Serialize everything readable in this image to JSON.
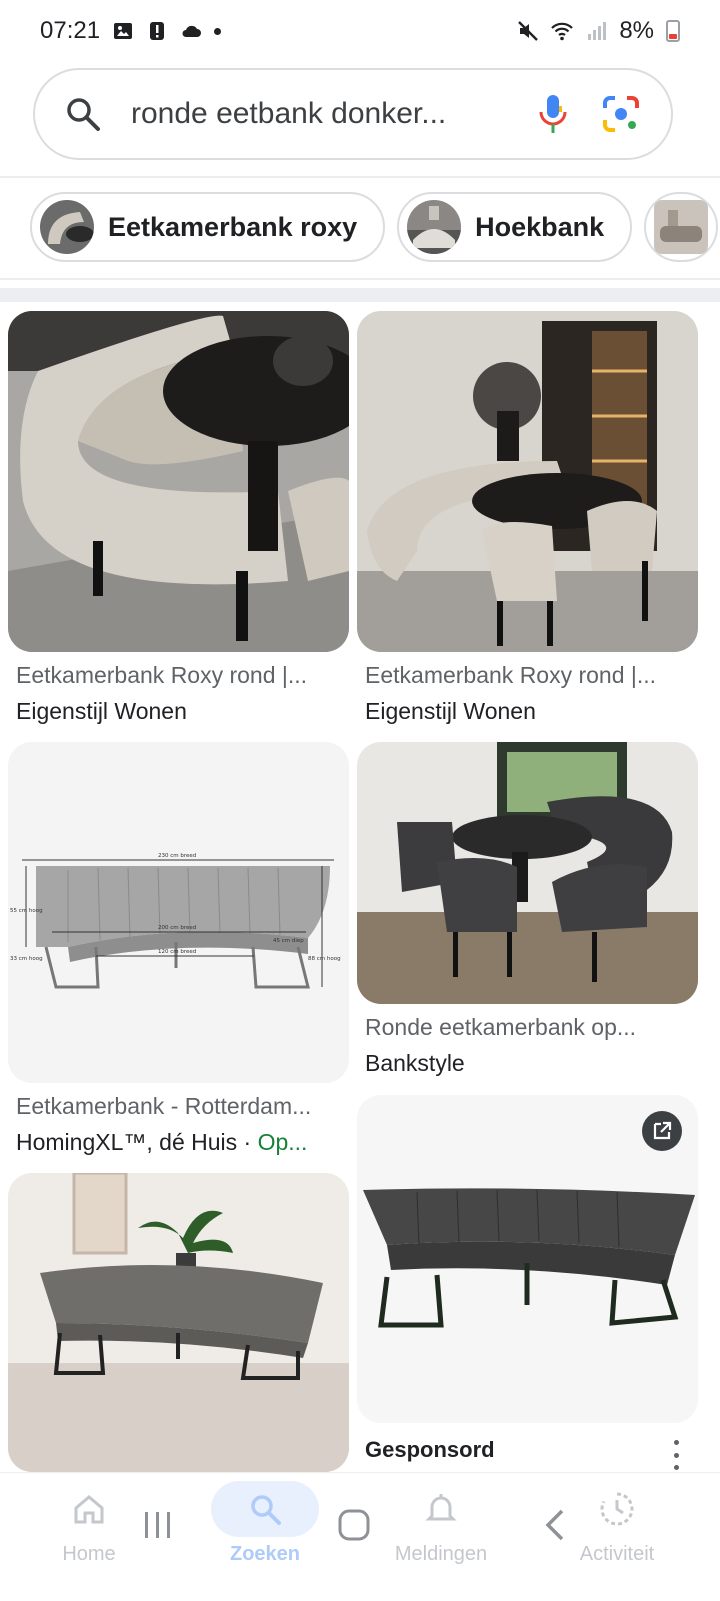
{
  "status_bar": {
    "time": "07:21",
    "battery": "8%",
    "icons": [
      "image-icon",
      "alert-icon",
      "cloud-icon",
      "mute-icon",
      "wifi-icon",
      "signal-icon",
      "battery-icon"
    ]
  },
  "search": {
    "query": "ronde eetbank donker...",
    "icons": [
      "search-icon",
      "mic-icon",
      "lens-icon"
    ]
  },
  "chips": [
    {
      "label": "Eetkamerbank roxy"
    },
    {
      "label": "Hoekbank"
    }
  ],
  "results": [
    {
      "title": "Eetkamerbank Roxy rond |...",
      "source": "Eigenstijl Wonen"
    },
    {
      "title": "Eetkamerbank Roxy rond |...",
      "source": "Eigenstijl Wonen"
    },
    {
      "title": "Eetkamerbank - Rotterdam...",
      "source": "HomingXL™, dé Huis · ",
      "badge": "Op..."
    },
    {
      "title": "Ronde eetkamerbank op...",
      "source": "Bankstyle"
    },
    {
      "title": "",
      "source": ""
    },
    {
      "title": "Gesponsord",
      "source": ""
    }
  ],
  "dimension_labels": {
    "width_total": "230 cm breed",
    "width_inner": "200 cm breed",
    "width_base": "120 cm breed",
    "depth": "45 cm diep",
    "height_seat": "55 cm hoog",
    "height_legs": "33 cm hoog",
    "height_total": "88 cm hoog"
  },
  "sponsored_label": "Gesponsord",
  "bottom_nav": [
    {
      "label": "Home"
    },
    {
      "label": "Zoeken"
    },
    {
      "label": "Meldingen"
    },
    {
      "label": "Activiteit"
    }
  ],
  "colors": {
    "accent": "#1a73e8",
    "chip_border": "#dadce0",
    "open_green": "#188038"
  }
}
